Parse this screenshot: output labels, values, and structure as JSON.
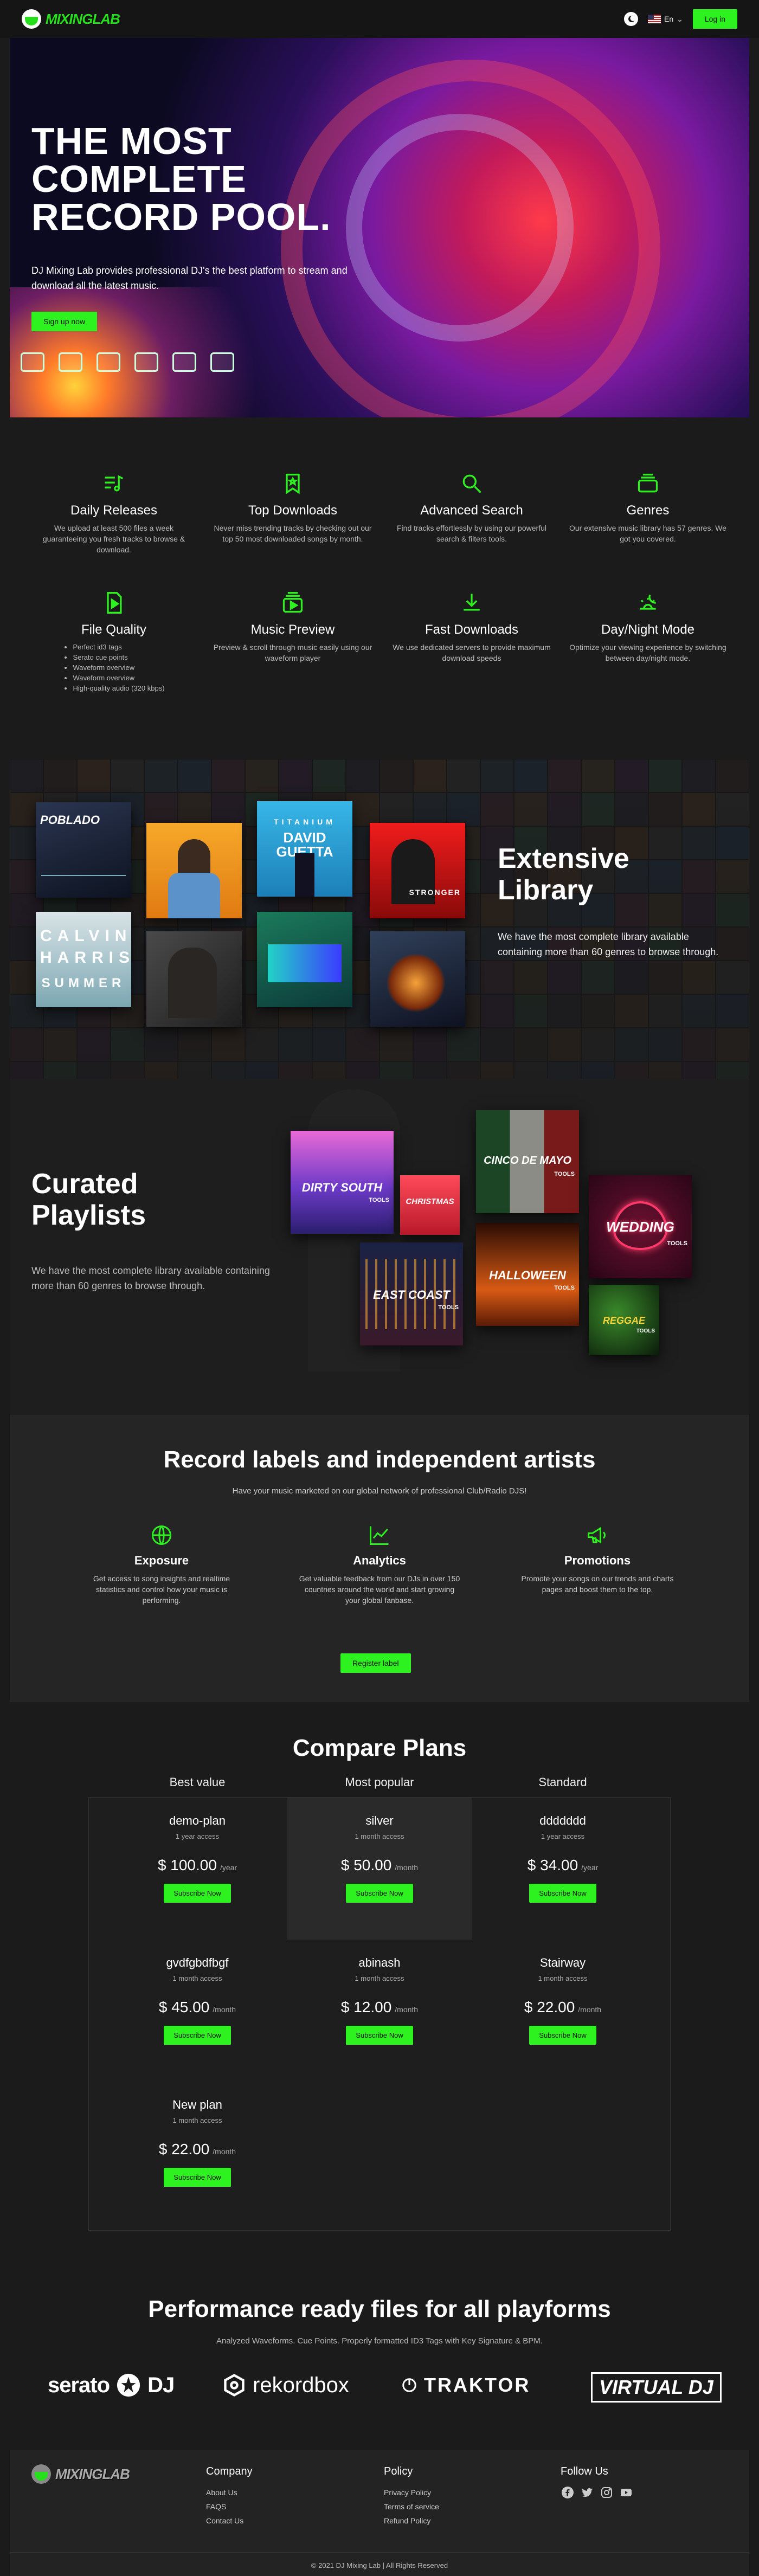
{
  "header": {
    "logo_text": "MIXINGLAB",
    "lang_label": "En",
    "login_label": "Log in"
  },
  "hero": {
    "title_line1": "THE MOST",
    "title_line2": "COMPLETE",
    "title_line3": "RECORD POOL.",
    "subtitle": "DJ Mixing Lab provides professional DJ's the best platform to stream and download all the latest music.",
    "cta_label": "Sign up now"
  },
  "features": [
    {
      "icon": "music-list-icon",
      "title": "Daily Releases",
      "text": "We upload at least 500 files a week guaranteeing you fresh tracks to browse & download."
    },
    {
      "icon": "bookmark-icon",
      "title": "Top Downloads",
      "text": "Never miss trending tracks by checking out our top 50 most downloaded songs by month."
    },
    {
      "icon": "search-icon",
      "title": "Advanced Search",
      "text": "Find tracks effortlessly by using our powerful search & filters tools."
    },
    {
      "icon": "stack-icon",
      "title": "Genres",
      "text": "Our extensive music library has 57 genres. We got you covered."
    },
    {
      "icon": "audio-file-icon",
      "title": "File Quality",
      "list": [
        "Perfect id3 tags",
        "Serato cue points",
        "Waveform overview",
        "Waveform overview",
        "High-quality audio (320 kbps)"
      ]
    },
    {
      "icon": "preview-icon",
      "title": "Music Preview",
      "text": "Preview & scroll through music easily using our waveform player"
    },
    {
      "icon": "download-icon",
      "title": "Fast Downloads",
      "text": "We use dedicated servers to provide maximum download speeds"
    },
    {
      "icon": "day-night-icon",
      "title": "Day/Night Mode",
      "text": "Optimize your viewing experience by switching between day/night mode."
    }
  ],
  "library": {
    "title_line1": "Extensive",
    "title_line2": "Library",
    "text": "We have the most complete library available containing more than 60 genres to browse through.",
    "covers": {
      "poblado": "POBLADO",
      "calvin1": "CALVIN",
      "calvin2": "HARRIS",
      "calvin3": "SUMMER",
      "titanium": "TITANIUM",
      "guetta": "DAVID GUETTA",
      "stronger": "STRONGER"
    }
  },
  "curated": {
    "title_line1": "Curated",
    "title_line2": "Playlists",
    "text": "We have the most complete library available containing more than 60 genres to browse through.",
    "covers": {
      "dirty_south": "DIRTY SOUTH",
      "christmas": "CHRISTMAS",
      "cinco": "CINCO DE MAYO",
      "wedding": "WEDDING",
      "east_coast": "EAST COAST",
      "halloween": "HALLOWEEN",
      "reggae": "REGGAE",
      "tools": "TOOLS"
    }
  },
  "labels": {
    "title": "Record labels and independent artists",
    "subtitle": "Have your music marketed on our global network of professional Club/Radio DJS!",
    "items": [
      {
        "icon": "globe-icon",
        "title": "Exposure",
        "text": "Get access to song insights and realtime statistics and control how your music is performing."
      },
      {
        "icon": "chart-line-icon",
        "title": "Analytics",
        "text": "Get valuable feedback from our DJs in over 150 countries around the world and start growing your global fanbase."
      },
      {
        "icon": "megaphone-icon",
        "title": "Promotions",
        "text": "Promote your songs on our trends and charts pages and boost them to the top."
      }
    ],
    "register_label": "Register label"
  },
  "plans": {
    "title": "Compare Plans",
    "headers": [
      "Best value",
      "Most popular",
      "Standard"
    ],
    "subscribe_label": "Subscribe Now",
    "items": [
      {
        "name": "demo-plan",
        "period": "1 year access",
        "price": "$ 100.00",
        "unit": "/year"
      },
      {
        "name": "silver",
        "period": "1 month access",
        "price": "$ 50.00",
        "unit": "/month"
      },
      {
        "name": "ddddddd",
        "period": "1 year access",
        "price": "$ 34.00",
        "unit": "/year"
      },
      {
        "name": "gvdfgbdfbgf",
        "period": "1 month access",
        "price": "$ 45.00",
        "unit": "/month"
      },
      {
        "name": "abinash",
        "period": "1 month access",
        "price": "$ 12.00",
        "unit": "/month"
      },
      {
        "name": "Stairway",
        "period": "1 month access",
        "price": "$ 22.00",
        "unit": "/month"
      },
      {
        "name": "New plan",
        "period": "1 month access",
        "price": "$ 22.00",
        "unit": "/month"
      }
    ]
  },
  "performance": {
    "title": "Performance ready files for all playforms",
    "subtitle": "Analyzed Waveforms. Cue Points. Properly formatted ID3 Tags with Key Signature & BPM.",
    "brands": {
      "serato": "serato",
      "serato_dj": "DJ",
      "rekordbox": "rekordbox",
      "traktor": "TRAKTOR",
      "virtualdj": "VIRTUAL DJ"
    }
  },
  "footer": {
    "logo_text": "MIXINGLAB",
    "company_title": "Company",
    "company_links": [
      "About Us",
      "FAQS",
      "Contact Us"
    ],
    "policy_title": "Policy",
    "policy_links": [
      "Privacy Policy",
      "Terms of service",
      "Refund Policy"
    ],
    "follow_title": "Follow Us",
    "copyright": "© 2021 DJ Mixing Lab | All Rights Reserved"
  },
  "colors": {
    "accent": "#2ef21f",
    "background": "#1b1b1b"
  }
}
